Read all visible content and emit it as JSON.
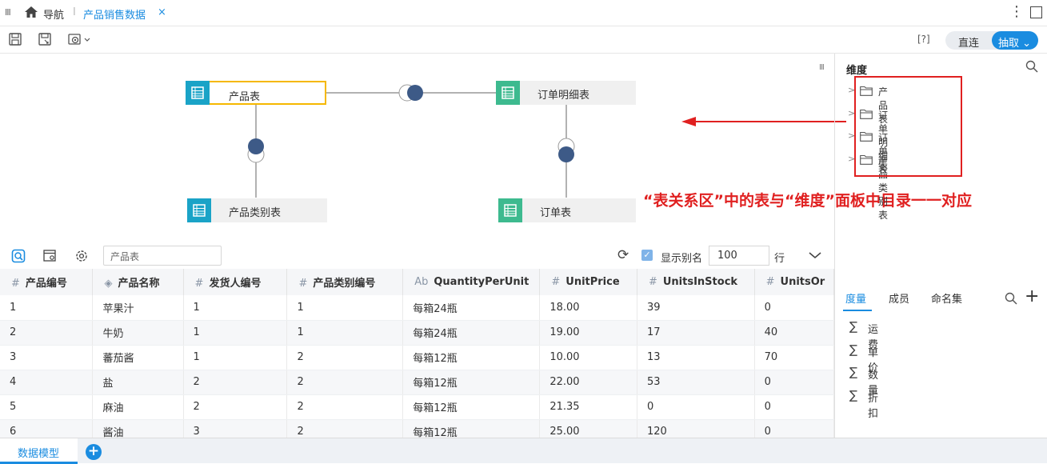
{
  "tabbar": {
    "nav_label": "导航",
    "separator": "I",
    "active_tab": "产品销售数据",
    "close": "×",
    "more": "⋮"
  },
  "toolbar": {
    "help": "[?]",
    "mode_direct": "直连",
    "mode_extract": "抽取 ⌄"
  },
  "canvas": {
    "nodes": [
      {
        "label": "产品表"
      },
      {
        "label": "订单明细表"
      },
      {
        "label": "产品类别表"
      },
      {
        "label": "订单表"
      }
    ]
  },
  "annotation": "“表关系区”中的表与“维度”面板中目录一一对应",
  "dimension_panel": {
    "title": "维度",
    "items": [
      {
        "label": "产品表"
      },
      {
        "label": "订单明细表"
      },
      {
        "label": "订单表"
      },
      {
        "label": "产品类别表"
      }
    ],
    "tabs": [
      {
        "label": "度量"
      },
      {
        "label": "成员"
      },
      {
        "label": "命名集"
      }
    ],
    "measures": [
      {
        "label": "运费"
      },
      {
        "label": "单价"
      },
      {
        "label": "数量"
      },
      {
        "label": "折扣"
      }
    ]
  },
  "preview": {
    "table_name": "产品表",
    "show_alias_label": "显示别名",
    "show_alias_checked": true,
    "row_count": "100",
    "row_unit": "行",
    "columns": [
      {
        "type": "#",
        "label": "产品编号"
      },
      {
        "type": "◈",
        "label": "产品名称"
      },
      {
        "type": "#",
        "label": "发货人编号"
      },
      {
        "type": "#",
        "label": "产品类别编号"
      },
      {
        "type": "Ab",
        "label": "QuantityPerUnit"
      },
      {
        "type": "#",
        "label": "UnitPrice"
      },
      {
        "type": "#",
        "label": "UnitsInStock"
      },
      {
        "type": "#",
        "label": "UnitsOr"
      }
    ],
    "rows": [
      [
        "1",
        "苹果汁",
        "1",
        "1",
        "每箱24瓶",
        "18.00",
        "39",
        "0"
      ],
      [
        "2",
        "牛奶",
        "1",
        "1",
        "每箱24瓶",
        "19.00",
        "17",
        "40"
      ],
      [
        "3",
        "蕃茄酱",
        "1",
        "2",
        "每箱12瓶",
        "10.00",
        "13",
        "70"
      ],
      [
        "4",
        "盐",
        "2",
        "2",
        "每箱12瓶",
        "22.00",
        "53",
        "0"
      ],
      [
        "5",
        "麻油",
        "2",
        "2",
        "每箱12瓶",
        "21.35",
        "0",
        "0"
      ],
      [
        "6",
        "酱油",
        "3",
        "2",
        "每箱12瓶",
        "25.00",
        "120",
        "0"
      ]
    ]
  },
  "bottom": {
    "sheet_label": "数据模型",
    "add_label": "+"
  }
}
